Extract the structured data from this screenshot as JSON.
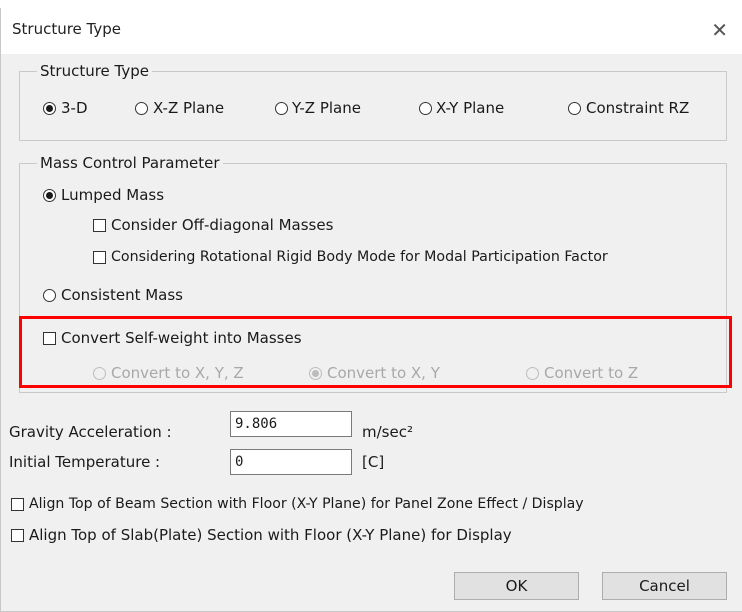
{
  "dialog": {
    "title": "Structure Type",
    "close_glyph": "✕"
  },
  "structure_type": {
    "legend": "Structure Type",
    "options": [
      "3-D",
      "X-Z Plane",
      "Y-Z Plane",
      "X-Y Plane",
      "Constraint RZ"
    ],
    "selected": "3-D"
  },
  "mass_control": {
    "legend": "Mass Control Parameter",
    "lumped_mass": "Lumped Mass",
    "off_diagonal": "Consider Off-diagonal Masses",
    "rotational": "Considering Rotational Rigid Body Mode for Modal Participation Factor",
    "consistent_mass": "Consistent Mass",
    "selected": "Lumped Mass"
  },
  "self_weight": {
    "convert_label": "Convert Self-weight into Masses",
    "options": [
      "Convert to X, Y, Z",
      "Convert to X, Y",
      "Convert to Z"
    ],
    "selected": "Convert to X, Y",
    "highlight_color": "#ff0000"
  },
  "gravity": {
    "label": "Gravity Acceleration :",
    "value": "9.806",
    "unit": "m/sec²"
  },
  "temperature": {
    "label": "Initial Temperature :",
    "value": "0",
    "unit": "[C]"
  },
  "align": {
    "beam": "Align Top of Beam Section with Floor (X-Y Plane) for Panel Zone Effect / Display",
    "slab": "Align Top of Slab(Plate) Section with Floor (X-Y Plane) for Display"
  },
  "buttons": {
    "ok": "OK",
    "cancel": "Cancel"
  }
}
